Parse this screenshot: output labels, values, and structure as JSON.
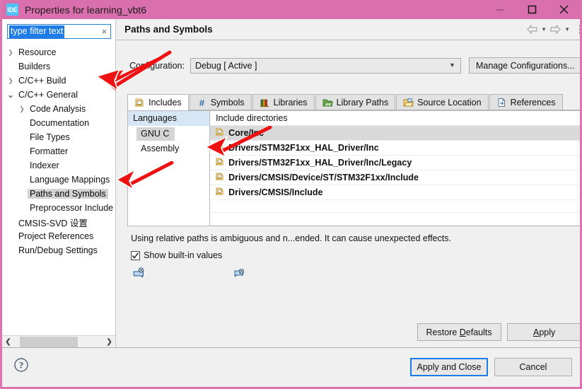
{
  "window": {
    "title": "Properties for learning_vbt6",
    "app_badge": "IDE",
    "titlebar_color": "#da6fad",
    "controls": {
      "minimize": "minimize-button",
      "maximize": "maximize-button",
      "close": "close-button"
    }
  },
  "filter": {
    "value": "type filter text",
    "placeholder": "type filter text",
    "clear": "×"
  },
  "tree": [
    {
      "label": "Resource",
      "indent": 0,
      "twisty": "collapsed",
      "selected": false
    },
    {
      "label": "Builders",
      "indent": 0,
      "twisty": "none",
      "selected": false
    },
    {
      "label": "C/C++ Build",
      "indent": 0,
      "twisty": "collapsed",
      "selected": false
    },
    {
      "label": "C/C++ General",
      "indent": 0,
      "twisty": "expanded",
      "selected": false
    },
    {
      "label": "Code Analysis",
      "indent": 1,
      "twisty": "collapsed",
      "selected": false
    },
    {
      "label": "Documentation",
      "indent": 1,
      "twisty": "none",
      "selected": false
    },
    {
      "label": "File Types",
      "indent": 1,
      "twisty": "none",
      "selected": false
    },
    {
      "label": "Formatter",
      "indent": 1,
      "twisty": "none",
      "selected": false
    },
    {
      "label": "Indexer",
      "indent": 1,
      "twisty": "none",
      "selected": false
    },
    {
      "label": "Language Mappings",
      "indent": 1,
      "twisty": "none",
      "selected": false
    },
    {
      "label": "Paths and Symbols",
      "indent": 1,
      "twisty": "none",
      "selected": true
    },
    {
      "label": "Preprocessor Include",
      "indent": 1,
      "twisty": "none",
      "selected": false
    },
    {
      "label": "CMSIS-SVD 设置",
      "indent": 0,
      "twisty": "none",
      "selected": false
    },
    {
      "label": "Project References",
      "indent": 0,
      "twisty": "none",
      "selected": false
    },
    {
      "label": "Run/Debug Settings",
      "indent": 0,
      "twisty": "none",
      "selected": false
    }
  ],
  "page": {
    "title": "Paths and Symbols",
    "nav": {
      "back": "back-arrow",
      "forward": "forward-arrow",
      "menu": "view-menu"
    }
  },
  "configuration": {
    "label": "Configuration:",
    "value": "Debug  [ Active ]",
    "manage_button": "Manage Configurations..."
  },
  "tabs": [
    {
      "label": "Includes",
      "icon": "includes-icon",
      "active": true
    },
    {
      "label": "Symbols",
      "icon": "hash-icon",
      "active": false
    },
    {
      "label": "Libraries",
      "icon": "books-icon",
      "active": false
    },
    {
      "label": "Library Paths",
      "icon": "folder-open-icon",
      "active": false
    },
    {
      "label": "Source Location",
      "icon": "source-folder-icon",
      "active": false
    },
    {
      "label": "References",
      "icon": "document-arrow-icon",
      "active": false
    }
  ],
  "languages": {
    "header": "Languages",
    "items": [
      {
        "label": "GNU C",
        "selected": true
      },
      {
        "label": "Assembly",
        "selected": false
      }
    ]
  },
  "include_directories": {
    "header": "Include directories",
    "rows": [
      {
        "path": "Core/Inc",
        "selected": true
      },
      {
        "path": "Drivers/STM32F1xx_HAL_Driver/Inc",
        "selected": false
      },
      {
        "path": "Drivers/STM32F1xx_HAL_Driver/Inc/Legacy",
        "selected": false
      },
      {
        "path": "Drivers/CMSIS/Device/ST/STM32F1xx/Include",
        "selected": false
      },
      {
        "path": "Drivers/CMSIS/Include",
        "selected": false
      }
    ]
  },
  "note": "Using relative paths is ambiguous and n...ended. It can cause unexpected effects.",
  "show_builtin": {
    "label": "Show built-in values",
    "checked": true
  },
  "mini_icons": [
    {
      "name": "export-settings-icon"
    },
    {
      "name": "import-settings-icon"
    }
  ],
  "buttons": {
    "restore_defaults": "Restore Defaults",
    "restore_defaults_mnemonic": "D",
    "apply": "Apply",
    "apply_mnemonic": "A",
    "apply_and_close": "Apply and Close",
    "cancel": "Cancel"
  },
  "footer": {
    "help": "help-button"
  },
  "annotations": {
    "color": "#ee1111",
    "count": 3
  }
}
